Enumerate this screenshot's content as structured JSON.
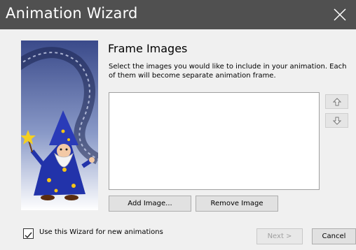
{
  "window": {
    "title": "Animation Wizard"
  },
  "page": {
    "title": "Frame Images",
    "description": "Select the images you would like to include in your animation. Each of them will become separate animation frame."
  },
  "buttons": {
    "add_image": "Add Image...",
    "remove_image": "Remove Image",
    "next": "Next >",
    "cancel": "Cancel"
  },
  "options": {
    "use_wizard_label": "Use this Wizard for new animations",
    "use_wizard_checked": true
  },
  "frames_list": {
    "items": []
  },
  "icons": [
    "close-icon",
    "arrow-up-icon",
    "arrow-down-icon",
    "wizard-illustration"
  ]
}
